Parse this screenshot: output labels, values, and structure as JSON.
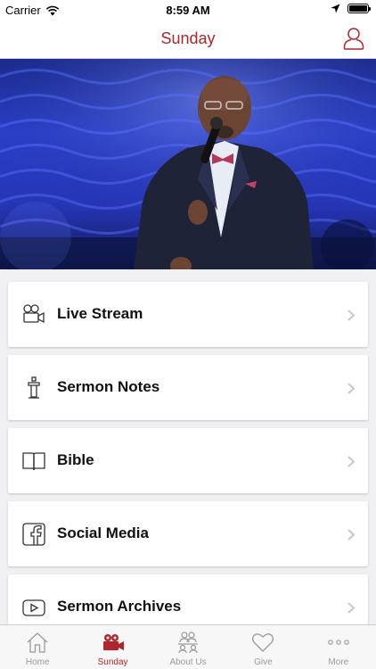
{
  "status_bar": {
    "carrier": "Carrier",
    "time": "8:59 AM"
  },
  "nav": {
    "title": "Sunday"
  },
  "colors": {
    "accent": "#b2242b",
    "tab_inactive": "#9a9a9a"
  },
  "menu": [
    {
      "label": "Live Stream",
      "icon": "video-camera-icon"
    },
    {
      "label": "Sermon Notes",
      "icon": "pulpit-icon"
    },
    {
      "label": "Bible",
      "icon": "book-icon"
    },
    {
      "label": "Social Media",
      "icon": "facebook-icon"
    },
    {
      "label": "Sermon Archives",
      "icon": "youtube-icon"
    }
  ],
  "tabs": [
    {
      "label": "Home",
      "icon": "home-icon",
      "active": false
    },
    {
      "label": "Sunday",
      "icon": "video-camera-icon",
      "active": true
    },
    {
      "label": "About Us",
      "icon": "people-icon",
      "active": false
    },
    {
      "label": "Give",
      "icon": "heart-icon",
      "active": false
    },
    {
      "label": "More",
      "icon": "more-dots-icon",
      "active": false
    }
  ]
}
